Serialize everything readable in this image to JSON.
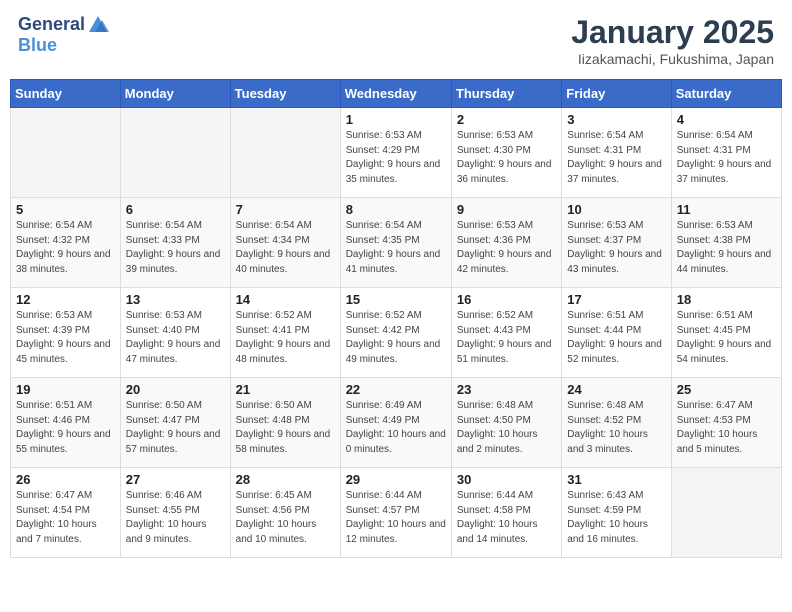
{
  "logo": {
    "line1": "General",
    "line2": "Blue"
  },
  "title": "January 2025",
  "subtitle": "Iizakamachi, Fukushima, Japan",
  "weekdays": [
    "Sunday",
    "Monday",
    "Tuesday",
    "Wednesday",
    "Thursday",
    "Friday",
    "Saturday"
  ],
  "weeks": [
    [
      {
        "day": "",
        "info": ""
      },
      {
        "day": "",
        "info": ""
      },
      {
        "day": "",
        "info": ""
      },
      {
        "day": "1",
        "info": "Sunrise: 6:53 AM\nSunset: 4:29 PM\nDaylight: 9 hours and 35 minutes."
      },
      {
        "day": "2",
        "info": "Sunrise: 6:53 AM\nSunset: 4:30 PM\nDaylight: 9 hours and 36 minutes."
      },
      {
        "day": "3",
        "info": "Sunrise: 6:54 AM\nSunset: 4:31 PM\nDaylight: 9 hours and 37 minutes."
      },
      {
        "day": "4",
        "info": "Sunrise: 6:54 AM\nSunset: 4:31 PM\nDaylight: 9 hours and 37 minutes."
      }
    ],
    [
      {
        "day": "5",
        "info": "Sunrise: 6:54 AM\nSunset: 4:32 PM\nDaylight: 9 hours and 38 minutes."
      },
      {
        "day": "6",
        "info": "Sunrise: 6:54 AM\nSunset: 4:33 PM\nDaylight: 9 hours and 39 minutes."
      },
      {
        "day": "7",
        "info": "Sunrise: 6:54 AM\nSunset: 4:34 PM\nDaylight: 9 hours and 40 minutes."
      },
      {
        "day": "8",
        "info": "Sunrise: 6:54 AM\nSunset: 4:35 PM\nDaylight: 9 hours and 41 minutes."
      },
      {
        "day": "9",
        "info": "Sunrise: 6:53 AM\nSunset: 4:36 PM\nDaylight: 9 hours and 42 minutes."
      },
      {
        "day": "10",
        "info": "Sunrise: 6:53 AM\nSunset: 4:37 PM\nDaylight: 9 hours and 43 minutes."
      },
      {
        "day": "11",
        "info": "Sunrise: 6:53 AM\nSunset: 4:38 PM\nDaylight: 9 hours and 44 minutes."
      }
    ],
    [
      {
        "day": "12",
        "info": "Sunrise: 6:53 AM\nSunset: 4:39 PM\nDaylight: 9 hours and 45 minutes."
      },
      {
        "day": "13",
        "info": "Sunrise: 6:53 AM\nSunset: 4:40 PM\nDaylight: 9 hours and 47 minutes."
      },
      {
        "day": "14",
        "info": "Sunrise: 6:52 AM\nSunset: 4:41 PM\nDaylight: 9 hours and 48 minutes."
      },
      {
        "day": "15",
        "info": "Sunrise: 6:52 AM\nSunset: 4:42 PM\nDaylight: 9 hours and 49 minutes."
      },
      {
        "day": "16",
        "info": "Sunrise: 6:52 AM\nSunset: 4:43 PM\nDaylight: 9 hours and 51 minutes."
      },
      {
        "day": "17",
        "info": "Sunrise: 6:51 AM\nSunset: 4:44 PM\nDaylight: 9 hours and 52 minutes."
      },
      {
        "day": "18",
        "info": "Sunrise: 6:51 AM\nSunset: 4:45 PM\nDaylight: 9 hours and 54 minutes."
      }
    ],
    [
      {
        "day": "19",
        "info": "Sunrise: 6:51 AM\nSunset: 4:46 PM\nDaylight: 9 hours and 55 minutes."
      },
      {
        "day": "20",
        "info": "Sunrise: 6:50 AM\nSunset: 4:47 PM\nDaylight: 9 hours and 57 minutes."
      },
      {
        "day": "21",
        "info": "Sunrise: 6:50 AM\nSunset: 4:48 PM\nDaylight: 9 hours and 58 minutes."
      },
      {
        "day": "22",
        "info": "Sunrise: 6:49 AM\nSunset: 4:49 PM\nDaylight: 10 hours and 0 minutes."
      },
      {
        "day": "23",
        "info": "Sunrise: 6:48 AM\nSunset: 4:50 PM\nDaylight: 10 hours and 2 minutes."
      },
      {
        "day": "24",
        "info": "Sunrise: 6:48 AM\nSunset: 4:52 PM\nDaylight: 10 hours and 3 minutes."
      },
      {
        "day": "25",
        "info": "Sunrise: 6:47 AM\nSunset: 4:53 PM\nDaylight: 10 hours and 5 minutes."
      }
    ],
    [
      {
        "day": "26",
        "info": "Sunrise: 6:47 AM\nSunset: 4:54 PM\nDaylight: 10 hours and 7 minutes."
      },
      {
        "day": "27",
        "info": "Sunrise: 6:46 AM\nSunset: 4:55 PM\nDaylight: 10 hours and 9 minutes."
      },
      {
        "day": "28",
        "info": "Sunrise: 6:45 AM\nSunset: 4:56 PM\nDaylight: 10 hours and 10 minutes."
      },
      {
        "day": "29",
        "info": "Sunrise: 6:44 AM\nSunset: 4:57 PM\nDaylight: 10 hours and 12 minutes."
      },
      {
        "day": "30",
        "info": "Sunrise: 6:44 AM\nSunset: 4:58 PM\nDaylight: 10 hours and 14 minutes."
      },
      {
        "day": "31",
        "info": "Sunrise: 6:43 AM\nSunset: 4:59 PM\nDaylight: 10 hours and 16 minutes."
      },
      {
        "day": "",
        "info": ""
      }
    ]
  ]
}
